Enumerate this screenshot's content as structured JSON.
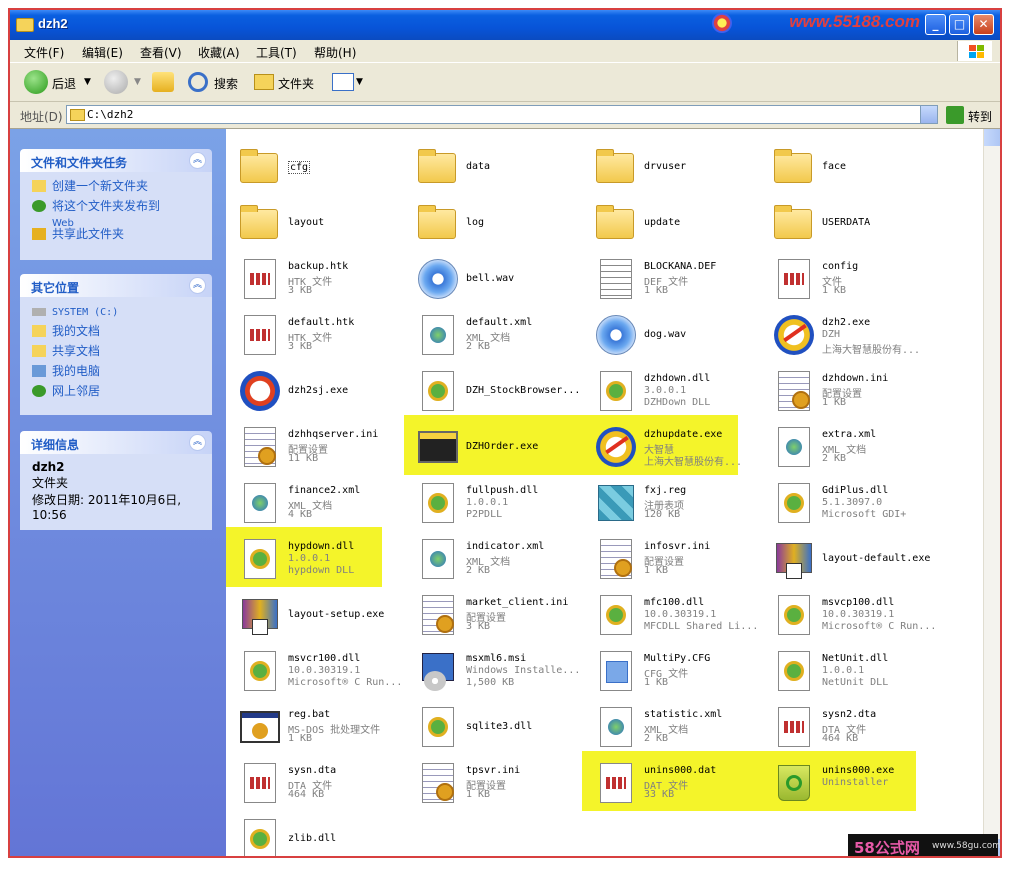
{
  "window": {
    "title": "dzh2",
    "watermark_top": "www.55188.com",
    "watermark_bottom": "58公式网",
    "watermark_bottom_url": "www.58gu.com"
  },
  "menu": [
    "文件(F)",
    "编辑(E)",
    "查看(V)",
    "收藏(A)",
    "工具(T)",
    "帮助(H)"
  ],
  "toolbar": {
    "back": "后退",
    "search": "搜索",
    "folders": "文件夹"
  },
  "address": {
    "label": "地址(D)",
    "path": "C:\\dzh2",
    "go": "转到"
  },
  "tasks": {
    "title": "文件和文件夹任务",
    "items": [
      "创建一个新文件夹",
      "将这个文件夹发布到",
      "Web",
      "共享此文件夹"
    ]
  },
  "places": {
    "title": "其它位置",
    "items": [
      "SYSTEM (C:)",
      "我的文档",
      "共享文档",
      "我的电脑",
      "网上邻居"
    ]
  },
  "details": {
    "title": "详细信息",
    "name": "dzh2",
    "type": "文件夹",
    "modified": "修改日期: 2011年10月6日,",
    "time": "10:56"
  },
  "files": [
    {
      "name": "cfg",
      "kind": "folder",
      "l1": "",
      "l2": ""
    },
    {
      "name": "data",
      "kind": "folder",
      "l1": "",
      "l2": ""
    },
    {
      "name": "drvuser",
      "kind": "folder",
      "l1": "",
      "l2": ""
    },
    {
      "name": "face",
      "kind": "folder",
      "l1": "",
      "l2": ""
    },
    {
      "name": "layout",
      "kind": "folder",
      "l1": "",
      "l2": ""
    },
    {
      "name": "log",
      "kind": "folder",
      "l1": "",
      "l2": ""
    },
    {
      "name": "update",
      "kind": "folder",
      "l1": "",
      "l2": ""
    },
    {
      "name": "USERDATA",
      "kind": "folder",
      "l1": "",
      "l2": ""
    },
    {
      "name": "backup.htk",
      "kind": "doc",
      "l1": "HTK 文件",
      "l2": "3 KB"
    },
    {
      "name": "bell.wav",
      "kind": "wav",
      "l1": "",
      "l2": ""
    },
    {
      "name": "BLOCKANA.DEF",
      "kind": "text",
      "l1": "DEF 文件",
      "l2": "1 KB"
    },
    {
      "name": "config",
      "kind": "doc",
      "l1": "文件",
      "l2": "1 KB"
    },
    {
      "name": "default.htk",
      "kind": "doc",
      "l1": "HTK 文件",
      "l2": "3 KB"
    },
    {
      "name": "default.xml",
      "kind": "xml",
      "l1": "XML 文档",
      "l2": "2 KB"
    },
    {
      "name": "dog.wav",
      "kind": "wav",
      "l1": "",
      "l2": ""
    },
    {
      "name": "dzh2.exe",
      "kind": "dzh",
      "l1": "DZH",
      "l2": "上海大智慧股份有..."
    },
    {
      "name": "dzh2sj.exe",
      "kind": "dzh2",
      "l1": "",
      "l2": ""
    },
    {
      "name": "DZH_StockBrowser...",
      "kind": "dll",
      "l1": "",
      "l2": ""
    },
    {
      "name": "dzhdown.dll",
      "kind": "dll",
      "l1": "3.0.0.1",
      "l2": "DZHDown DLL"
    },
    {
      "name": "dzhdown.ini",
      "kind": "ini",
      "l1": "配置设置",
      "l2": "1 KB"
    },
    {
      "name": "dzhhqserver.ini",
      "kind": "ini",
      "l1": "配置设置",
      "l2": "11 KB"
    },
    {
      "name": "DZHOrder.exe",
      "kind": "app",
      "l1": "",
      "l2": ""
    },
    {
      "name": "dzhupdate.exe",
      "kind": "dzh",
      "l1": "大智慧",
      "l2": "上海大智慧股份有..."
    },
    {
      "name": "extra.xml",
      "kind": "xml",
      "l1": "XML 文档",
      "l2": "2 KB"
    },
    {
      "name": "finance2.xml",
      "kind": "xml",
      "l1": "XML 文档",
      "l2": "4 KB"
    },
    {
      "name": "fullpush.dll",
      "kind": "dll",
      "l1": "1.0.0.1",
      "l2": "P2PDLL"
    },
    {
      "name": "fxj.reg",
      "kind": "reg",
      "l1": "注册表项",
      "l2": "120 KB"
    },
    {
      "name": "GdiPlus.dll",
      "kind": "dll",
      "l1": "5.1.3097.0",
      "l2": "Microsoft GDI+"
    },
    {
      "name": "hypdown.dll",
      "kind": "dll",
      "l1": "1.0.0.1",
      "l2": "hypdown DLL"
    },
    {
      "name": "indicator.xml",
      "kind": "xml",
      "l1": "XML 文档",
      "l2": "2 KB"
    },
    {
      "name": "infosvr.ini",
      "kind": "ini",
      "l1": "配置设置",
      "l2": "1 KB"
    },
    {
      "name": "layout-default.exe",
      "kind": "setup",
      "l1": "",
      "l2": ""
    },
    {
      "name": "layout-setup.exe",
      "kind": "setup",
      "l1": "",
      "l2": ""
    },
    {
      "name": "market_client.ini",
      "kind": "ini",
      "l1": "配置设置",
      "l2": "3 KB"
    },
    {
      "name": "mfc100.dll",
      "kind": "dll",
      "l1": "10.0.30319.1",
      "l2": "MFCDLL Shared Li..."
    },
    {
      "name": "msvcp100.dll",
      "kind": "dll",
      "l1": "10.0.30319.1",
      "l2": "Microsoft® C Run..."
    },
    {
      "name": "msvcr100.dll",
      "kind": "dll",
      "l1": "10.0.30319.1",
      "l2": "Microsoft® C Run..."
    },
    {
      "name": "msxml6.msi",
      "kind": "msi",
      "l1": "Windows Installe...",
      "l2": "1,500 KB"
    },
    {
      "name": "MultiPy.CFG",
      "kind": "cfgfile",
      "l1": "CFG 文件",
      "l2": "1 KB"
    },
    {
      "name": "NetUnit.dll",
      "kind": "dll",
      "l1": "1.0.0.1",
      "l2": "NetUnit DLL"
    },
    {
      "name": "reg.bat",
      "kind": "bat",
      "l1": "MS-DOS 批处理文件",
      "l2": "1 KB"
    },
    {
      "name": "sqlite3.dll",
      "kind": "dll",
      "l1": "",
      "l2": ""
    },
    {
      "name": "statistic.xml",
      "kind": "xml",
      "l1": "XML 文档",
      "l2": "2 KB"
    },
    {
      "name": "sysn2.dta",
      "kind": "doc",
      "l1": "DTA 文件",
      "l2": "464 KB"
    },
    {
      "name": "sysn.dta",
      "kind": "doc",
      "l1": "DTA 文件",
      "l2": "464 KB"
    },
    {
      "name": "tpsvr.ini",
      "kind": "ini",
      "l1": "配置设置",
      "l2": "1 KB"
    },
    {
      "name": "unins000.dat",
      "kind": "doc",
      "l1": "DAT 文件",
      "l2": "33 KB"
    },
    {
      "name": "unins000.exe",
      "kind": "uninst",
      "l1": "Uninstaller",
      "l2": ""
    },
    {
      "name": "zlib.dll",
      "kind": "dll",
      "l1": "",
      "l2": ""
    }
  ],
  "colors": {
    "highlight": "#f4f42a",
    "link": "#215dc6",
    "titlebar": "#0854d8"
  }
}
